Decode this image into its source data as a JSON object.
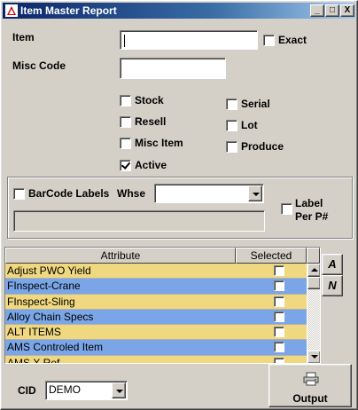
{
  "window": {
    "title": "Item Master Report",
    "controls": {
      "minimize": "_",
      "maximize": "□",
      "close": "X"
    }
  },
  "filters": {
    "item_label": "Item",
    "item_value": "",
    "exact_label": "Exact",
    "exact_checked": false,
    "misc_code_label": "Misc Code",
    "misc_code_value": ""
  },
  "options": {
    "stock": {
      "label": "Stock",
      "checked": false
    },
    "resell": {
      "label": "Resell",
      "checked": false
    },
    "misc_item": {
      "label": "Misc Item",
      "checked": false
    },
    "active": {
      "label": "Active",
      "checked": true
    },
    "serial": {
      "label": "Serial",
      "checked": false
    },
    "lot": {
      "label": "Lot",
      "checked": false
    },
    "produce": {
      "label": "Produce",
      "checked": false
    }
  },
  "barcode": {
    "barcode_labels": "BarCode Labels",
    "whse_label": "Whse",
    "whse_value": "",
    "label_per_line1": "Label",
    "label_per_line2": "Per P#"
  },
  "grid": {
    "columns": [
      "Attribute",
      "Selected"
    ],
    "rows": [
      {
        "attribute": "Adjust PWO Yield",
        "selected": false,
        "color": "#efd87f"
      },
      {
        "attribute": "FInspect-Crane",
        "selected": false,
        "color": "#7aa6e8"
      },
      {
        "attribute": "FInspect-Sling",
        "selected": false,
        "color": "#efd87f"
      },
      {
        "attribute": "Alloy Chain Specs",
        "selected": false,
        "color": "#7aa6e8"
      },
      {
        "attribute": "ALT ITEMS",
        "selected": false,
        "color": "#efd87f"
      },
      {
        "attribute": "AMS Controled Item",
        "selected": false,
        "color": "#7aa6e8"
      },
      {
        "attribute": "AMS X Ref",
        "selected": false,
        "color": "#efd87f"
      }
    ]
  },
  "side_buttons": {
    "all": "A",
    "none": "N"
  },
  "footer": {
    "cid_label": "CID",
    "cid_value": "DEMO",
    "output_label": "Output",
    "printer_icon": "printer-icon"
  }
}
